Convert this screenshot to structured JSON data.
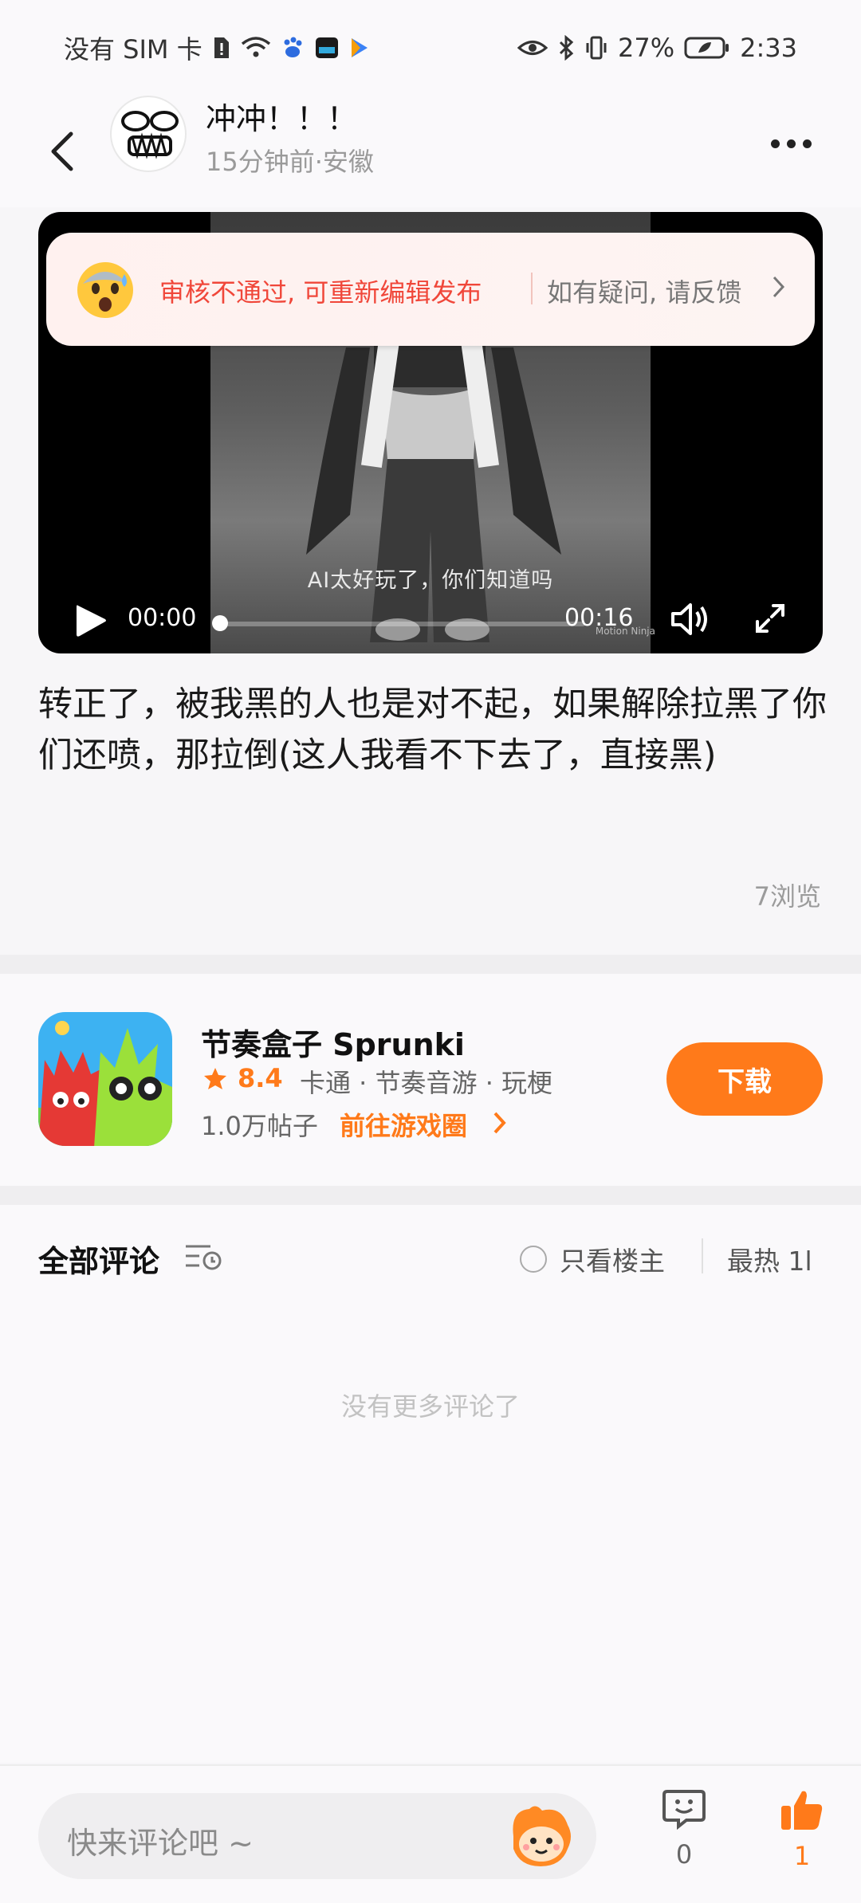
{
  "status_bar": {
    "carrier": "没有 SIM 卡",
    "battery": "27%",
    "time": "2:33"
  },
  "post": {
    "author": "冲冲！！！",
    "meta": "15分钟前·安徽",
    "text": "转正了，被我黑的人也是对不起，如果解除拉黑了你们还喷，那拉倒(这人我看不下去了，直接黑)",
    "views": "7浏览"
  },
  "video": {
    "caption": "AI太好玩了，你们知道吗",
    "current_time": "00:00",
    "total_time": "00:16",
    "progress": 0,
    "watermark": "Motion Ninja"
  },
  "review_banner": {
    "reject_text": "审核不通过, 可重新编辑发布",
    "feedback_text": "如有疑问, 请反馈"
  },
  "game": {
    "name": "节奏盒子 Sprunki",
    "rating": "8.4",
    "tags": "卡通 · 节奏音游 · 玩梗",
    "posts": "1.0万帖子",
    "circle_link": "前往游戏圈",
    "download_label": "下载"
  },
  "comments": {
    "title": "全部评论",
    "op_only": "只看楼主",
    "sort": "最热 1l",
    "empty": "没有更多评论了"
  },
  "bottom": {
    "input_placeholder": "快来评论吧 ~",
    "comment_count": "0",
    "like_count": "1"
  },
  "colors": {
    "accent": "#ff7a1a",
    "reject": "#f0473a"
  }
}
